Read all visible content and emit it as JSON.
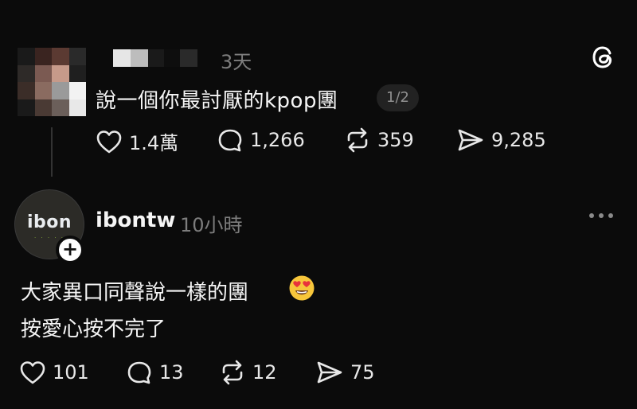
{
  "post1": {
    "time": "3天",
    "text": "說一個你最討厭的kpop團",
    "page_indicator": "1/2",
    "actions": {
      "likes": "1.4萬",
      "replies": "1,266",
      "reposts": "359",
      "shares": "9,285"
    }
  },
  "post2": {
    "avatar_text": "ibon",
    "username": "ibontw",
    "time": "10小時",
    "line1": "大家異口同聲說一樣的團",
    "line2": "按愛心按不完了",
    "emoji": "heart-eyes",
    "actions": {
      "likes": "101",
      "replies": "13",
      "reposts": "12",
      "shares": "75"
    }
  },
  "icons": [
    "threads-logo-icon",
    "heart-icon",
    "comment-icon",
    "repost-icon",
    "share-icon",
    "more-icon",
    "plus-icon"
  ],
  "colors": {
    "background": "#0b0b0b",
    "text": "#f5f5f5",
    "muted": "#7d7d7d",
    "ibon_green": "#8db83a"
  }
}
